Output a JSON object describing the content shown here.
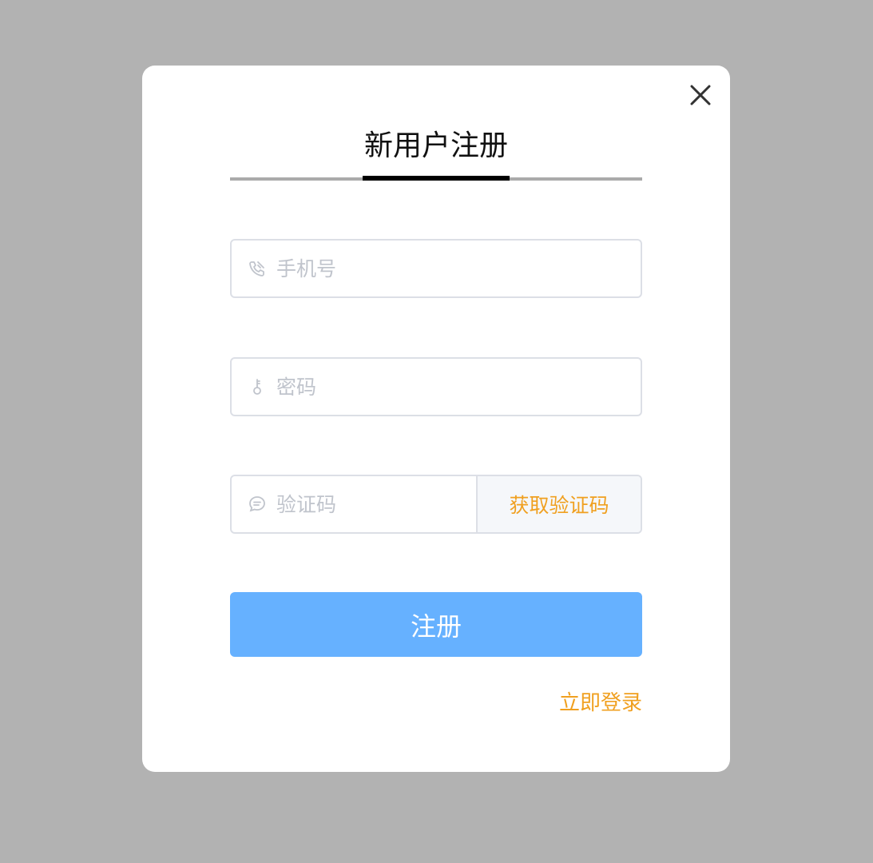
{
  "dialog": {
    "tab_title": "新用户注册",
    "close_icon": "close-icon"
  },
  "form": {
    "phone": {
      "placeholder": "手机号",
      "value": "",
      "icon": "phone-icon"
    },
    "password": {
      "placeholder": "密码",
      "value": "",
      "icon": "key-icon"
    },
    "code": {
      "placeholder": "验证码",
      "value": "",
      "icon": "message-icon",
      "button_label": "获取验证码"
    }
  },
  "actions": {
    "submit_label": "注册",
    "login_link_label": "立即登录"
  },
  "colors": {
    "overlay": "#b2b2b2",
    "primary_button": "#66b1ff",
    "accent_link": "#f0a020",
    "placeholder": "#c0c4cc"
  }
}
